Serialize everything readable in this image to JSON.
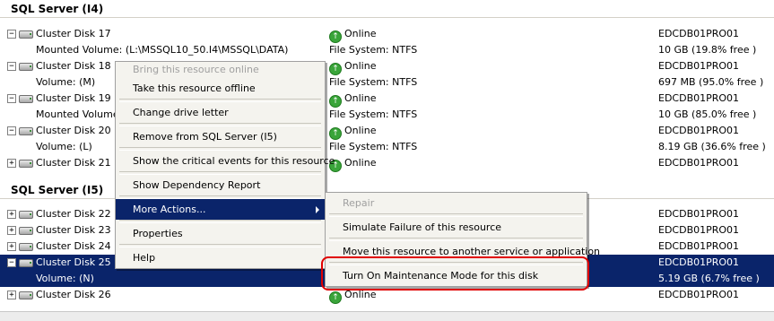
{
  "groups": [
    {
      "title": "SQL Server (I4)"
    },
    {
      "title": "SQL Server (I5)"
    }
  ],
  "rows_i4": [
    {
      "toggle": "−",
      "name": "Cluster Disk 17",
      "status": "Online",
      "owner": "EDCDB01PRO01"
    },
    {
      "name": "Mounted Volume: (L:\\MSSQL10_50.I4\\MSSQL\\DATA)",
      "fs": "File System: NTFS",
      "owner": "10 GB (19.8% free )"
    },
    {
      "toggle": "−",
      "name": "Cluster Disk 18",
      "status": "Online",
      "owner": "EDCDB01PRO01"
    },
    {
      "name": "Volume: (M)",
      "fs": "File System: NTFS",
      "owner": "697 MB (95.0% free )"
    },
    {
      "toggle": "−",
      "name": "Cluster Disk 19",
      "status": "Online",
      "owner": "EDCDB01PRO01"
    },
    {
      "name": "Mounted Volume:",
      "fs": "File System: NTFS",
      "owner": "10 GB (85.0% free )"
    },
    {
      "toggle": "−",
      "name": "Cluster Disk 20",
      "status": "Online",
      "owner": "EDCDB01PRO01"
    },
    {
      "name": "Volume: (L)",
      "fs": "File System: NTFS",
      "owner": "8.19 GB (36.6% free )"
    },
    {
      "toggle": "+",
      "name": "Cluster Disk 21",
      "status": "Online",
      "owner": "EDCDB01PRO01"
    }
  ],
  "rows_i5": [
    {
      "toggle": "+",
      "name": "Cluster Disk 22",
      "owner": "EDCDB01PRO01"
    },
    {
      "toggle": "+",
      "name": "Cluster Disk 23",
      "owner": "EDCDB01PRO01"
    },
    {
      "toggle": "+",
      "name": "Cluster Disk 24",
      "owner": "EDCDB01PRO01"
    },
    {
      "toggle": "−",
      "name": "Cluster Disk 25",
      "owner": "EDCDB01PRO01"
    },
    {
      "name": "Volume: (N)",
      "owner": "5.19 GB (6.7% free )"
    },
    {
      "toggle": "+",
      "name": "Cluster Disk 26",
      "status": "Online",
      "owner": "EDCDB01PRO01"
    }
  ],
  "context_menu": {
    "items": [
      {
        "label": "Bring this resource online",
        "disabled": true
      },
      {
        "label": "Take this resource offline"
      },
      {
        "sep": true
      },
      {
        "label": "Change drive letter"
      },
      {
        "sep": true
      },
      {
        "label": "Remove from SQL Server (I5)"
      },
      {
        "sep": true
      },
      {
        "label": "Show the critical events for this resource"
      },
      {
        "sep": true
      },
      {
        "label": "Show Dependency Report"
      },
      {
        "sep": true
      },
      {
        "label": "More Actions...",
        "highlight": true,
        "submenu": true
      },
      {
        "sep": true
      },
      {
        "label": "Properties"
      },
      {
        "sep": true
      },
      {
        "label": "Help"
      }
    ]
  },
  "submenu": {
    "items": [
      {
        "label": "Repair",
        "disabled": true
      },
      {
        "sep": true
      },
      {
        "label": "Simulate Failure of this resource"
      },
      {
        "sep": true
      },
      {
        "label": "Move this resource to another service or application"
      },
      {
        "sep": true
      },
      {
        "label": "Turn On Maintenance Mode for this disk"
      }
    ]
  },
  "colors": {
    "selection": "#0a246a",
    "online": "#3aa53a",
    "highlight_ring": "#e00000"
  }
}
